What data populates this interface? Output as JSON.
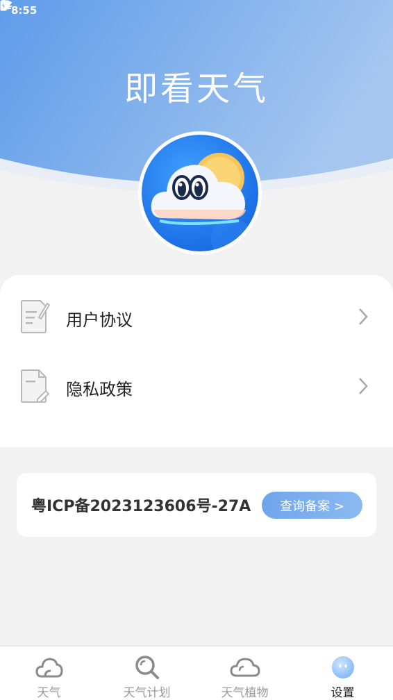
{
  "status_bar": {
    "time": "8:55"
  },
  "app": {
    "title": "即看天气"
  },
  "menu": {
    "items": [
      {
        "label": "用户协议",
        "icon": "document-edit-icon"
      },
      {
        "label": "隐私政策",
        "icon": "document-pen-icon"
      }
    ]
  },
  "icp": {
    "text": "粤ICP备2023123606号-27A",
    "button_label": "查询备案 >"
  },
  "bottom_nav": {
    "items": [
      {
        "label": "天气",
        "icon": "cloud-icon",
        "active": false
      },
      {
        "label": "天气计划",
        "icon": "magnifier-icon",
        "active": false
      },
      {
        "label": "天气植物",
        "icon": "cloud-outline-icon",
        "active": false
      },
      {
        "label": "设置",
        "icon": "face-icon",
        "active": true
      }
    ]
  },
  "colors": {
    "header_gradient_start": "#5f9ce9",
    "header_gradient_end": "#a5c6ef",
    "accent": "#7aaeee",
    "background": "#f2f2f2"
  }
}
